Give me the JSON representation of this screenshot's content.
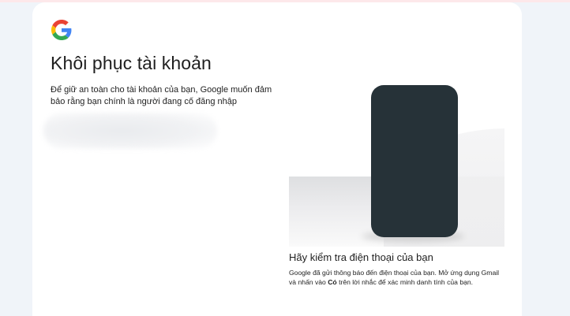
{
  "page": {
    "title": "Khôi phục tài khoản",
    "description": "Để giữ an toàn cho tài khoản của bạn, Google muốn đảm bảo rằng bạn chính là người đang cố đăng nhập"
  },
  "logo": {
    "icon": "google-g-icon",
    "colors": [
      "#4285F4",
      "#EA4335",
      "#FBBC05",
      "#34A853"
    ]
  },
  "illustration": {
    "phone_color": "#263238"
  },
  "verification": {
    "heading": "Hãy kiểm tra điện thoại của bạn",
    "text_before": "Google đã gửi thông báo đến điện thoại của bạn. Mở ứng dụng Gmail và nhấn vào ",
    "bold_word": "Có",
    "text_after": " trên lời nhắc để xác minh danh tính của bạn."
  }
}
